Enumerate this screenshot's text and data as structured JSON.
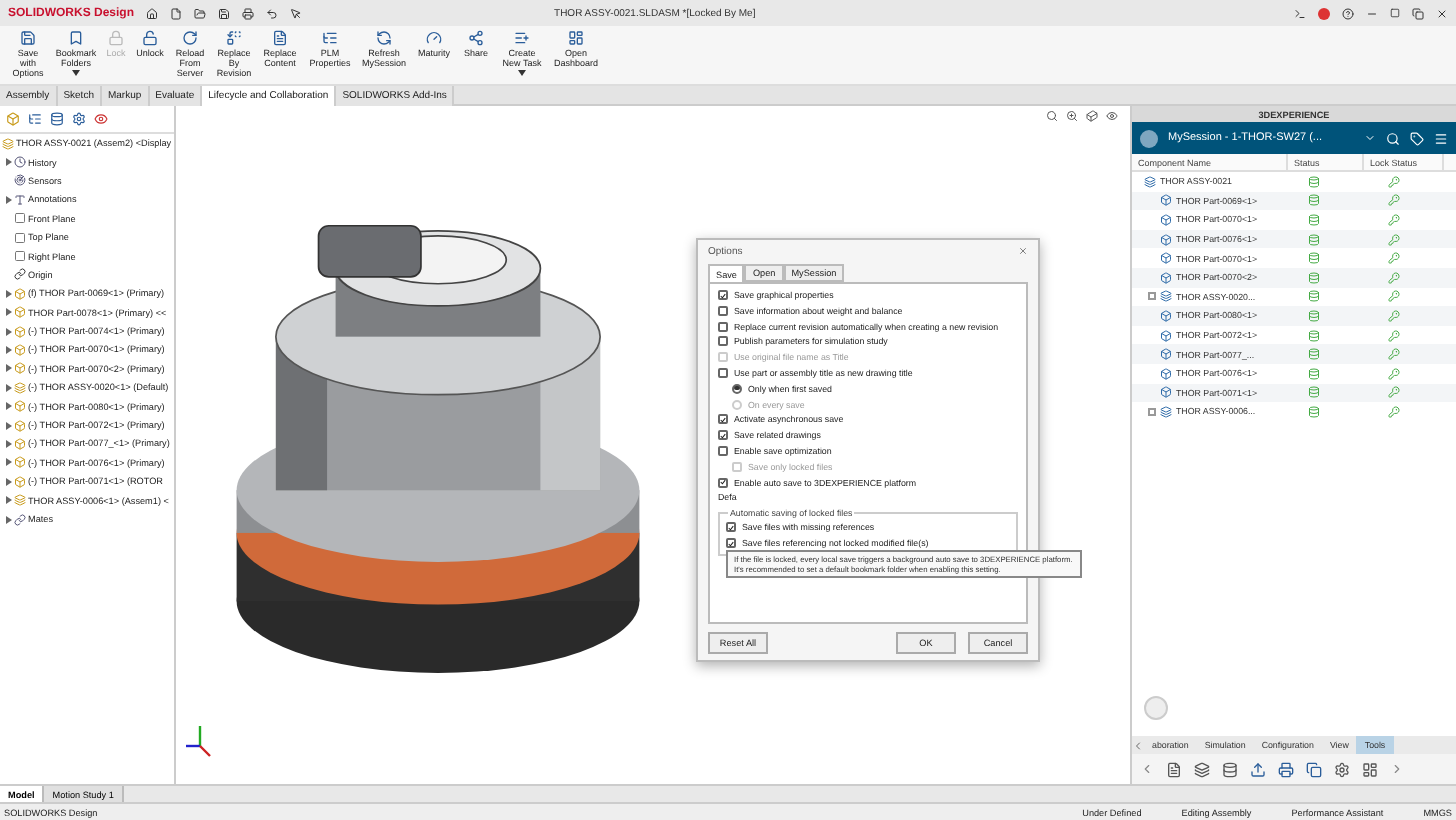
{
  "app": {
    "brand": "SOLIDWORKS Design",
    "title": "THOR ASSY-0021.SLDASM *[Locked By Me]"
  },
  "ribbon": [
    {
      "label": "Save with Options",
      "disabled": false,
      "dropdown": false
    },
    {
      "label": "Bookmark Folders",
      "disabled": false,
      "dropdown": true
    },
    {
      "label": "Lock",
      "disabled": true,
      "dropdown": false
    },
    {
      "label": "Unlock",
      "disabled": false,
      "dropdown": false
    },
    {
      "label": "Reload From Server",
      "disabled": false,
      "dropdown": false
    },
    {
      "label": "Replace By Revision",
      "disabled": false,
      "dropdown": false
    },
    {
      "label": "Replace Content",
      "disabled": false,
      "dropdown": false
    },
    {
      "label": "PLM Properties",
      "disabled": false,
      "dropdown": false
    },
    {
      "label": "Refresh MySession",
      "disabled": false,
      "dropdown": false
    },
    {
      "label": "Maturity",
      "disabled": false,
      "dropdown": false
    },
    {
      "label": "Share",
      "disabled": false,
      "dropdown": false
    },
    {
      "label": "Create New Task",
      "disabled": false,
      "dropdown": true
    },
    {
      "label": "Open Dashboard",
      "disabled": false,
      "dropdown": false
    }
  ],
  "tabs": [
    {
      "label": "Assembly",
      "selected": false
    },
    {
      "label": "Sketch",
      "selected": false
    },
    {
      "label": "Markup",
      "selected": false
    },
    {
      "label": "Evaluate",
      "selected": false
    },
    {
      "label": "Lifecycle and Collaboration",
      "selected": true
    },
    {
      "label": "SOLIDWORKS Add-Ins",
      "selected": false
    }
  ],
  "tree": {
    "root": {
      "label": "THOR ASSY-0021 (Assem2) <Display",
      "kind": "assembly",
      "children": [
        {
          "label": "History",
          "kind": "history",
          "expandable": true
        },
        {
          "label": "Sensors",
          "kind": "sensors",
          "expandable": false
        },
        {
          "label": "Annotations",
          "kind": "annotations",
          "expandable": true
        },
        {
          "label": "Front Plane",
          "kind": "plane",
          "expandable": false
        },
        {
          "label": "Top Plane",
          "kind": "plane",
          "expandable": false
        },
        {
          "label": "Right Plane",
          "kind": "plane",
          "expandable": false
        },
        {
          "label": "Origin",
          "kind": "origin",
          "expandable": false
        },
        {
          "label": "(f) THOR Part-0069<1> (Primary)",
          "kind": "part",
          "expandable": true
        },
        {
          "label": "THOR Part-0078<1> (Primary) <<",
          "kind": "part",
          "expandable": true
        },
        {
          "label": "(-) THOR Part-0074<1> (Primary)",
          "kind": "part",
          "expandable": true
        },
        {
          "label": "(-) THOR Part-0070<1> (Primary)",
          "kind": "part",
          "expandable": true
        },
        {
          "label": "(-) THOR Part-0070<2> (Primary)",
          "kind": "part",
          "expandable": true
        },
        {
          "label": "(-) THOR ASSY-0020<1> (Default)",
          "kind": "assembly",
          "expandable": true
        },
        {
          "label": "(-) THOR Part-0080<1> (Primary)",
          "kind": "part",
          "expandable": true
        },
        {
          "label": "(-) THOR Part-0072<1> (Primary)",
          "kind": "part",
          "expandable": true
        },
        {
          "label": "(-) THOR Part-0077_<1> (Primary)",
          "kind": "part",
          "expandable": true
        },
        {
          "label": "(-) THOR Part-0076<1> (Primary)",
          "kind": "part",
          "expandable": true
        },
        {
          "label": "(-) THOR Part-0071<1> (ROTOR",
          "kind": "part",
          "expandable": true
        },
        {
          "label": "THOR ASSY-0006<1> (Assem1) <",
          "kind": "assembly",
          "expandable": true
        },
        {
          "label": "Mates",
          "kind": "mates",
          "expandable": true
        }
      ]
    }
  },
  "dialog": {
    "title": "Options",
    "tabs": [
      {
        "label": "Save",
        "selected": true
      },
      {
        "label": "Open",
        "selected": false
      },
      {
        "label": "MySession",
        "selected": false
      }
    ],
    "options": [
      {
        "kind": "checkbox",
        "label": "Save graphical properties",
        "checked": true,
        "disabled": false
      },
      {
        "kind": "checkbox",
        "label": "Save information about weight and balance",
        "checked": false,
        "disabled": false
      },
      {
        "kind": "checkbox",
        "label": "Replace current revision automatically when creating a new revision",
        "checked": false,
        "disabled": false
      },
      {
        "kind": "checkbox",
        "label": "Publish parameters for simulation study",
        "checked": false,
        "disabled": false
      },
      {
        "kind": "checkbox",
        "label": "Use original file name as Title",
        "checked": false,
        "disabled": true
      },
      {
        "kind": "checkbox",
        "label": "Use part or assembly title as new drawing title",
        "checked": false,
        "disabled": false,
        "children": [
          {
            "kind": "radio",
            "label": "Only when first saved",
            "checked": true,
            "disabled": false
          },
          {
            "kind": "radio",
            "label": "On every save",
            "checked": false,
            "disabled": true
          }
        ]
      },
      {
        "kind": "checkbox",
        "label": "Activate asynchronous save",
        "checked": true,
        "disabled": false
      },
      {
        "kind": "checkbox",
        "label": "Save related drawings",
        "checked": true,
        "disabled": false
      },
      {
        "kind": "checkbox",
        "label": "Enable save optimization",
        "checked": false,
        "disabled": false,
        "children": [
          {
            "kind": "checkbox",
            "label": "Save only locked files",
            "checked": false,
            "disabled": true
          }
        ]
      },
      {
        "kind": "checkbox",
        "label": "Enable auto save to 3DEXPERIENCE platform",
        "checked": true,
        "disabled": false
      }
    ],
    "field_label": "Defa",
    "group": {
      "title": "Automatic saving of locked files",
      "options": [
        {
          "label": "Save files with missing references",
          "checked": true
        },
        {
          "label": "Save files referencing not locked modified file(s)",
          "checked": true
        }
      ]
    },
    "tooltip": [
      "If the file is locked, every local save triggers a background auto save to 3DEXPERIENCE platform.",
      "It's recommended to set a default bookmark folder when enabling this setting."
    ],
    "buttons": [
      "Reset All",
      "OK",
      "Cancel"
    ]
  },
  "panel": {
    "title": "3DEXPERIENCE",
    "session": "MySession - 1-THOR-SW27 (...",
    "columns": [
      "Component Name",
      "Status",
      "Lock Status"
    ],
    "rows": [
      {
        "name": "THOR ASSY-0021",
        "kind": "assembly"
      },
      {
        "name": "THOR Part-0069<1>",
        "kind": "part"
      },
      {
        "name": "THOR Part-0070<1>",
        "kind": "part"
      },
      {
        "name": "THOR Part-0076<1>",
        "kind": "part"
      },
      {
        "name": "THOR Part-0070<1>",
        "kind": "part"
      },
      {
        "name": "THOR Part-0070<2>",
        "kind": "part"
      },
      {
        "name": "THOR ASSY-0020...",
        "kind": "assembly"
      },
      {
        "name": "THOR Part-0080<1>",
        "kind": "part"
      },
      {
        "name": "THOR Part-0072<1>",
        "kind": "part"
      },
      {
        "name": "THOR Part-0077_...",
        "kind": "part"
      },
      {
        "name": "THOR Part-0076<1>",
        "kind": "part"
      },
      {
        "name": "THOR Part-0071<1>",
        "kind": "part"
      },
      {
        "name": "THOR ASSY-0006...",
        "kind": "assembly"
      }
    ],
    "bottom_tabs": [
      {
        "label": "aboration",
        "selected": false
      },
      {
        "label": "Simulation",
        "selected": false
      },
      {
        "label": "Configuration",
        "selected": false
      },
      {
        "label": "View",
        "selected": false
      },
      {
        "label": "Tools",
        "selected": true
      }
    ]
  },
  "model_tabs": [
    {
      "label": "Model",
      "selected": true
    },
    {
      "label": "Motion Study 1",
      "selected": false
    }
  ],
  "status_bar": {
    "left": "SOLIDWORKS Design",
    "items": [
      "Under Defined",
      "Editing Assembly",
      "Performance Assistant",
      "MMGS"
    ]
  }
}
